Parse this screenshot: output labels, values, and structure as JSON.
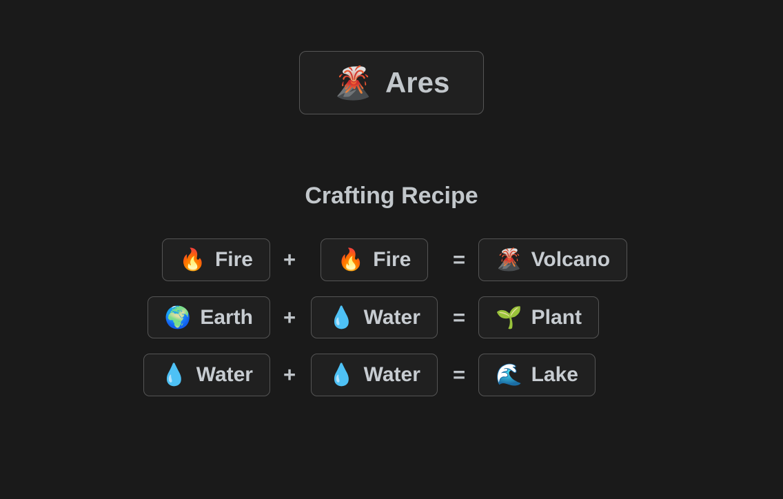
{
  "theme": {
    "background": "#1a1a1a",
    "card_background": "#202020",
    "card_border": "#555555",
    "text": "#c7ccd1"
  },
  "header": {
    "element": {
      "icon": "volcano-emoji",
      "emoji": "🌋",
      "name": "Ares"
    }
  },
  "recipe_section": {
    "title": "Crafting Recipe",
    "plus_operator": "+",
    "equals_operator": "=",
    "recipes": [
      {
        "input_a": {
          "emoji": "🔥",
          "icon": "fire-emoji",
          "label": "Fire"
        },
        "input_b": {
          "emoji": "🔥",
          "icon": "fire-emoji",
          "label": "Fire"
        },
        "result": {
          "emoji": "🌋",
          "icon": "volcano-emoji",
          "label": "Volcano"
        }
      },
      {
        "input_a": {
          "emoji": "🌍",
          "icon": "earth-globe-emoji",
          "label": "Earth"
        },
        "input_b": {
          "emoji": "💧",
          "icon": "droplet-emoji",
          "label": "Water"
        },
        "result": {
          "emoji": "🌱",
          "icon": "seedling-emoji",
          "label": "Plant"
        }
      },
      {
        "input_a": {
          "emoji": "💧",
          "icon": "droplet-emoji",
          "label": "Water"
        },
        "input_b": {
          "emoji": "💧",
          "icon": "droplet-emoji",
          "label": "Water"
        },
        "result": {
          "emoji": "🌊",
          "icon": "water-wave-emoji",
          "label": "Lake"
        }
      }
    ]
  }
}
